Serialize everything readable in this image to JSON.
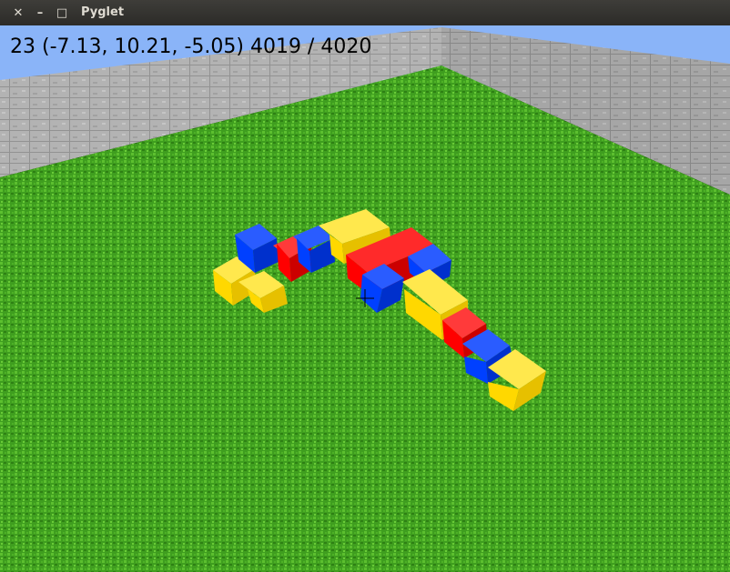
{
  "window": {
    "title": "Pyglet",
    "close_glyph": "✕",
    "minimize_glyph": "–",
    "maximize_glyph": "□"
  },
  "hud": {
    "fps": "23",
    "position": "(-7.13, 10.21, -5.05)",
    "blocks_shown": "4019",
    "blocks_total": "4020",
    "text": "23 (-7.13, 10.21, -5.05) 4019 / 4020"
  },
  "scene": {
    "sky_color": "#8ab4f8",
    "grass_color": "#3f9e1f",
    "wall_color": "#b9b9b9",
    "block_colors": {
      "yellow": "#ffd800",
      "red": "#ff0000",
      "blue": "#0040ff"
    },
    "crosshair": "crosshair-icon"
  }
}
